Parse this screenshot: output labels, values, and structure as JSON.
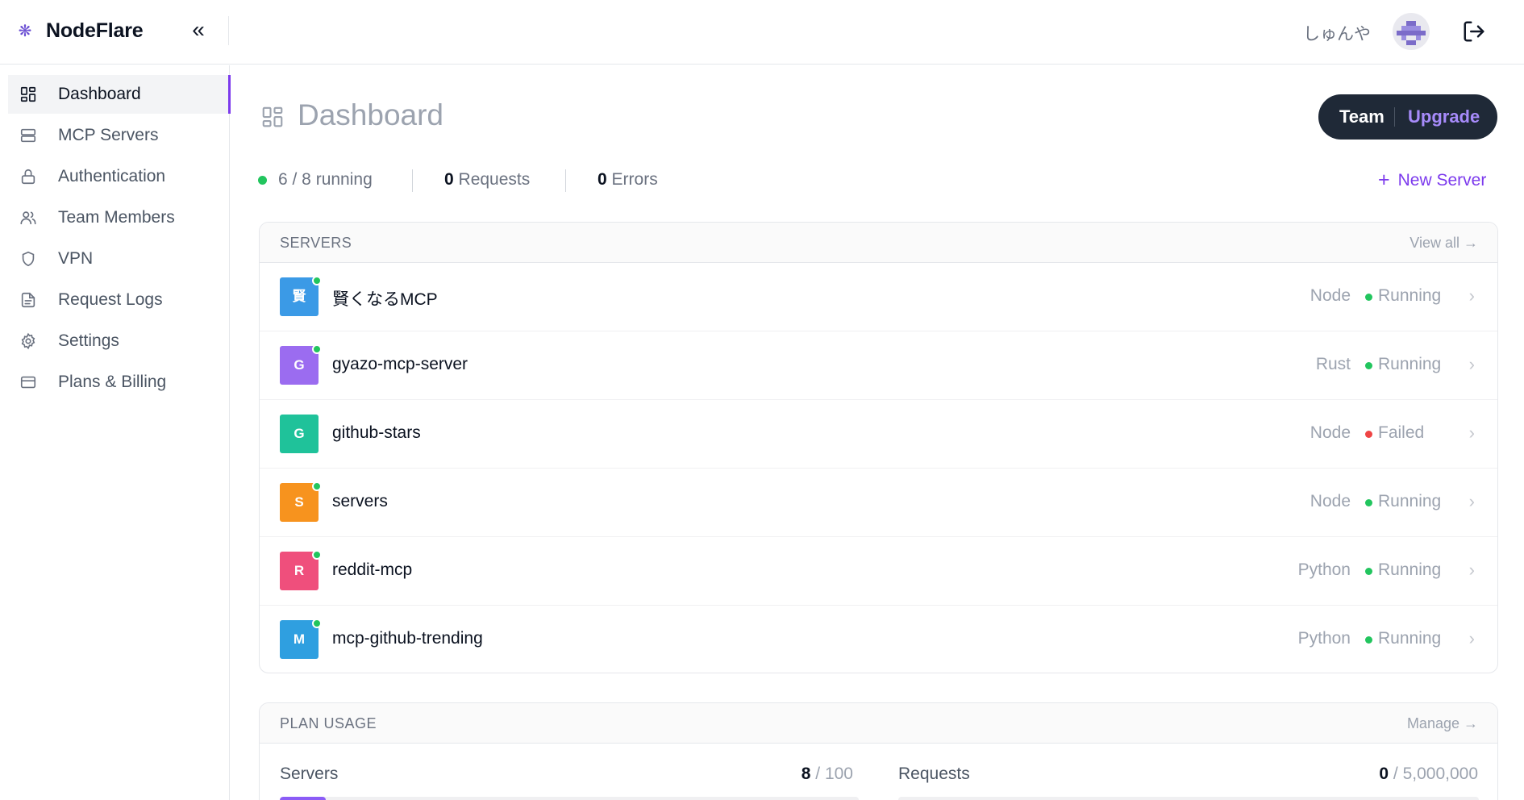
{
  "app": {
    "brand": "NodeFlare",
    "username": "しゅんや",
    "collapse_glyph": "«"
  },
  "sidebar": {
    "items": [
      {
        "label": "Dashboard",
        "icon": "dashboard-icon",
        "active": true
      },
      {
        "label": "MCP Servers",
        "icon": "server-icon",
        "active": false
      },
      {
        "label": "Authentication",
        "icon": "lock-icon",
        "active": false
      },
      {
        "label": "Team Members",
        "icon": "users-icon",
        "active": false
      },
      {
        "label": "VPN",
        "icon": "shield-icon",
        "active": false
      },
      {
        "label": "Request Logs",
        "icon": "file-text-icon",
        "active": false
      },
      {
        "label": "Settings",
        "icon": "gear-icon",
        "active": false
      },
      {
        "label": "Plans & Billing",
        "icon": "credit-card-icon",
        "active": false
      }
    ]
  },
  "main": {
    "title": "Dashboard",
    "plan": {
      "name": "Team",
      "action": "Upgrade"
    },
    "stats": {
      "running": "6 / 8 running",
      "requests_count": "0",
      "requests_label": "Requests",
      "errors_count": "0",
      "errors_label": "Errors"
    },
    "new_server_label": "New Server",
    "servers_card": {
      "title": "SERVERS",
      "view_all": "View all →",
      "rows": [
        {
          "initial": "賢",
          "name": "賢くなるMCP",
          "runtime": "Node",
          "status": "Running",
          "color": "#3b9ae6",
          "online": true
        },
        {
          "initial": "G",
          "name": "gyazo-mcp-server",
          "runtime": "Rust",
          "status": "Running",
          "color": "#9b6cf0",
          "online": true
        },
        {
          "initial": "G",
          "name": "github-stars",
          "runtime": "Node",
          "status": "Failed",
          "color": "#1fc29a",
          "online": false
        },
        {
          "initial": "S",
          "name": "servers",
          "runtime": "Node",
          "status": "Running",
          "color": "#f7931e",
          "online": true
        },
        {
          "initial": "R",
          "name": "reddit-mcp",
          "runtime": "Python",
          "status": "Running",
          "color": "#ef4f7c",
          "online": true
        },
        {
          "initial": "M",
          "name": "mcp-github-trending",
          "runtime": "Python",
          "status": "Running",
          "color": "#2f9fe0",
          "online": true
        }
      ]
    },
    "usage_card": {
      "title": "PLAN USAGE",
      "manage": "Manage →",
      "servers": {
        "label": "Servers",
        "used": "8",
        "limit": "/ 100",
        "fraction": 0.08
      },
      "requests": {
        "label": "Requests",
        "used": "0",
        "limit": "/ 5,000,000",
        "fraction": 0
      }
    }
  },
  "colors": {
    "accent": "#7c3aed",
    "running": "#22c55e",
    "failed": "#ef4444"
  }
}
